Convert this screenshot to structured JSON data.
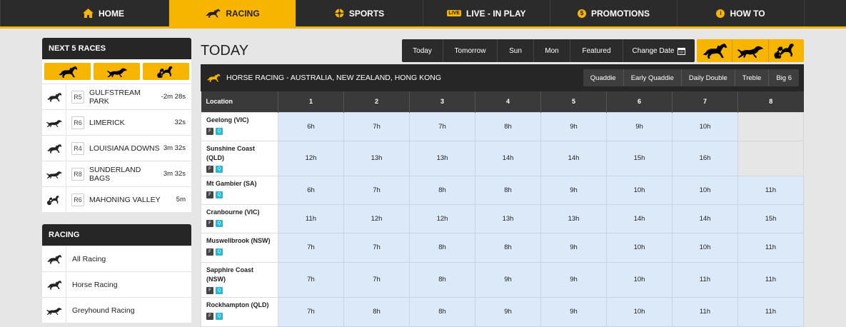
{
  "nav": [
    {
      "label": "HOME",
      "icon": "home-icon"
    },
    {
      "label": "RACING",
      "icon": "horse-icon",
      "active": true
    },
    {
      "label": "SPORTS",
      "icon": "sports-icon"
    },
    {
      "label": "LIVE - IN PLAY",
      "icon": "live-icon",
      "badge": "LIVE"
    },
    {
      "label": "PROMOTIONS",
      "icon": "promotions-icon",
      "glyph": "$"
    },
    {
      "label": "HOW TO",
      "icon": "info-icon",
      "glyph": "i"
    }
  ],
  "next_races": {
    "title": "NEXT 5 RACES",
    "items": [
      {
        "type": "horse",
        "race": "R5",
        "name": "GULFSTREAM PARK",
        "time": "-2m 28s"
      },
      {
        "type": "greyhound",
        "race": "R6",
        "name": "LIMERICK",
        "time": "32s"
      },
      {
        "type": "horse",
        "race": "R4",
        "name": "LOUISIANA DOWNS",
        "time": "3m 32s"
      },
      {
        "type": "greyhound",
        "race": "R8",
        "name": "SUNDERLAND BAGS",
        "time": "3m 32s"
      },
      {
        "type": "harness",
        "race": "R6",
        "name": "MAHONING VALLEY",
        "time": "5m"
      }
    ]
  },
  "racing_menu": {
    "title": "RACING",
    "items": [
      {
        "type": "horse",
        "label": "All Racing"
      },
      {
        "type": "horse",
        "label": "Horse Racing"
      },
      {
        "type": "greyhound",
        "label": "Greyhound Racing"
      }
    ]
  },
  "page_title": "TODAY",
  "date_tabs": [
    "Today",
    "Tomorrow",
    "Sun",
    "Mon",
    "Featured",
    "Change Date"
  ],
  "section": {
    "title": "HORSE RACING - AUSTRALIA, NEW ZEALAND, HONG KONG",
    "bet_tabs": [
      "Quaddie",
      "Early Quaddie",
      "Daily Double",
      "Treble",
      "Big 6"
    ]
  },
  "table": {
    "location_header": "Location",
    "columns": [
      "1",
      "2",
      "3",
      "4",
      "5",
      "6",
      "7",
      "8"
    ],
    "badges": {
      "f": "F",
      "q": "Q"
    },
    "rows": [
      {
        "location": "Geelong (VIC)",
        "times": [
          "6h",
          "7h",
          "7h",
          "8h",
          "9h",
          "9h",
          "10h",
          ""
        ]
      },
      {
        "location": "Sunshine Coast (QLD)",
        "times": [
          "12h",
          "13h",
          "13h",
          "14h",
          "14h",
          "15h",
          "16h",
          ""
        ]
      },
      {
        "location": "Mt Gambier (SA)",
        "times": [
          "6h",
          "7h",
          "8h",
          "8h",
          "9h",
          "10h",
          "10h",
          "11h"
        ]
      },
      {
        "location": "Cranbourne (VIC)",
        "times": [
          "11h",
          "12h",
          "12h",
          "13h",
          "13h",
          "14h",
          "14h",
          "15h"
        ]
      },
      {
        "location": "Muswellbrook (NSW)",
        "times": [
          "7h",
          "7h",
          "8h",
          "8h",
          "9h",
          "10h",
          "10h",
          "11h"
        ]
      },
      {
        "location": "Sapphire Coast (NSW)",
        "times": [
          "7h",
          "7h",
          "8h",
          "9h",
          "9h",
          "10h",
          "11h",
          "11h"
        ]
      },
      {
        "location": "Rockhampton (QLD)",
        "times": [
          "7h",
          "8h",
          "8h",
          "9h",
          "9h",
          "10h",
          "11h",
          "11h"
        ]
      }
    ]
  },
  "colors": {
    "accent": "#f7b500",
    "dark": "#2b2b2b",
    "cell": "#dce9f9"
  }
}
